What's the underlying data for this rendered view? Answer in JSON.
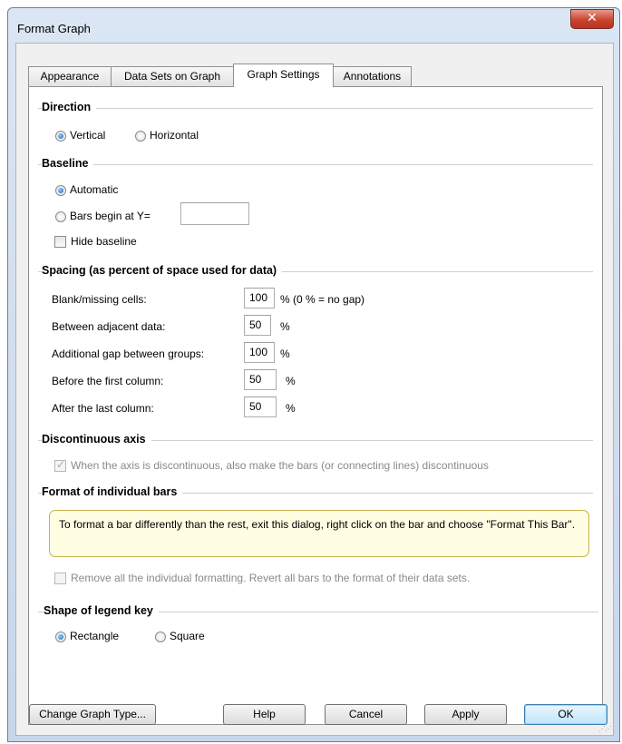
{
  "window": {
    "title": "Format Graph",
    "close_glyph": "✕"
  },
  "tabs": [
    {
      "label": "Appearance"
    },
    {
      "label": "Data Sets on Graph"
    },
    {
      "label": "Graph Settings",
      "active": true
    },
    {
      "label": "Annotations"
    }
  ],
  "direction": {
    "heading": "Direction",
    "vertical": "Vertical",
    "horizontal": "Horizontal",
    "selected": "Vertical"
  },
  "baseline": {
    "heading": "Baseline",
    "automatic": "Automatic",
    "bars_begin": "Bars begin at Y=",
    "bars_begin_value": "",
    "hide": "Hide baseline",
    "selected": "Automatic",
    "hide_checked": false
  },
  "spacing": {
    "heading": "Spacing (as percent of space used for data)",
    "rows": [
      {
        "label": "Blank/missing cells:",
        "value": "100",
        "unit": "% (0 % = no gap)"
      },
      {
        "label": "Between adjacent data:",
        "value": "50",
        "unit": "%"
      },
      {
        "label": "Additional gap between groups:",
        "value": "100",
        "unit": "%"
      },
      {
        "label": "Before the first column:",
        "value": "50",
        "unit": "%"
      },
      {
        "label": "After the last column:",
        "value": "50",
        "unit": "%"
      }
    ]
  },
  "discontinuous": {
    "heading": "Discontinuous axis",
    "option": "When the axis is discontinuous, also make the bars (or connecting lines) discontinuous",
    "checked": true,
    "enabled": false
  },
  "individual": {
    "heading": "Format of individual bars",
    "note": "To format a bar differently than the rest, exit this dialog, right click on the bar and choose \"Format This Bar\".",
    "remove": "Remove all the individual formatting. Revert all bars to the format of their data sets.",
    "remove_checked": false
  },
  "legend": {
    "heading": "Shape of legend key",
    "rectangle": "Rectangle",
    "square": "Square",
    "selected": "Rectangle"
  },
  "buttons": {
    "change_type": "Change Graph Type...",
    "help": "Help",
    "cancel": "Cancel",
    "apply": "Apply",
    "ok": "OK"
  },
  "icons": {
    "close": "close-icon",
    "checkmark": "checkmark-icon",
    "resize_grip": "resize-grip-icon"
  },
  "colors": {
    "close_button": "#c9452f",
    "note_bg": "#fffde2",
    "note_border": "#c8b14e",
    "default_button": "#bee6fd"
  }
}
